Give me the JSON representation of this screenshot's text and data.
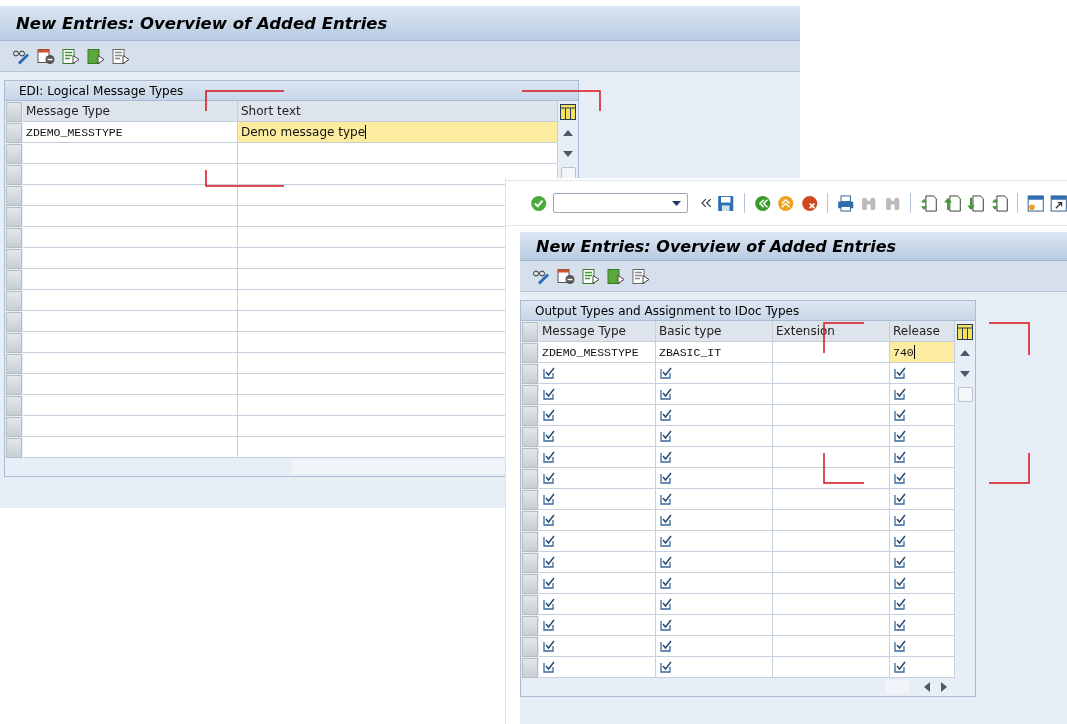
{
  "back_window": {
    "title": "New Entries: Overview of Added Entries",
    "table": {
      "title": "EDI: Logical Message Types",
      "columns": [
        {
          "label": "Message Type",
          "mono": true
        },
        {
          "label": "Short text",
          "mono": false
        }
      ],
      "rows": [
        {
          "kind": "data",
          "cells": [
            {
              "text": "ZDEMO_MESSTYPE",
              "focused": false
            },
            {
              "text": "Demo message type",
              "focused": true
            }
          ]
        },
        {
          "kind": "empty"
        },
        {
          "kind": "empty"
        },
        {
          "kind": "empty"
        },
        {
          "kind": "empty"
        },
        {
          "kind": "empty"
        },
        {
          "kind": "empty"
        },
        {
          "kind": "empty"
        },
        {
          "kind": "empty"
        },
        {
          "kind": "empty"
        },
        {
          "kind": "empty"
        },
        {
          "kind": "empty"
        },
        {
          "kind": "empty"
        },
        {
          "kind": "empty"
        },
        {
          "kind": "empty"
        },
        {
          "kind": "empty"
        }
      ]
    }
  },
  "front_window": {
    "title": "New Entries: Overview of Added Entries",
    "table": {
      "title": "Output Types and Assignment to IDoc Types",
      "columns": [
        {
          "label": "Message Type",
          "mono": true,
          "tick": true
        },
        {
          "label": "Basic type",
          "mono": true,
          "tick": true
        },
        {
          "label": "Extension",
          "tick": false
        },
        {
          "label": "Release",
          "mono": true,
          "tick": true
        }
      ],
      "rows": [
        {
          "kind": "data",
          "cells": [
            {
              "text": "ZDEMO_MESSTYPE",
              "focused": false
            },
            {
              "text": "ZBASIC_IT",
              "focused": false
            },
            {
              "focused": false
            },
            {
              "text": "740",
              "focused": true
            }
          ]
        },
        {
          "kind": "template"
        },
        {
          "kind": "template"
        },
        {
          "kind": "template"
        },
        {
          "kind": "template"
        },
        {
          "kind": "template"
        },
        {
          "kind": "template"
        },
        {
          "kind": "template"
        },
        {
          "kind": "template"
        },
        {
          "kind": "template"
        },
        {
          "kind": "template"
        },
        {
          "kind": "template"
        },
        {
          "kind": "template"
        },
        {
          "kind": "template"
        },
        {
          "kind": "template"
        },
        {
          "kind": "template"
        }
      ]
    }
  }
}
